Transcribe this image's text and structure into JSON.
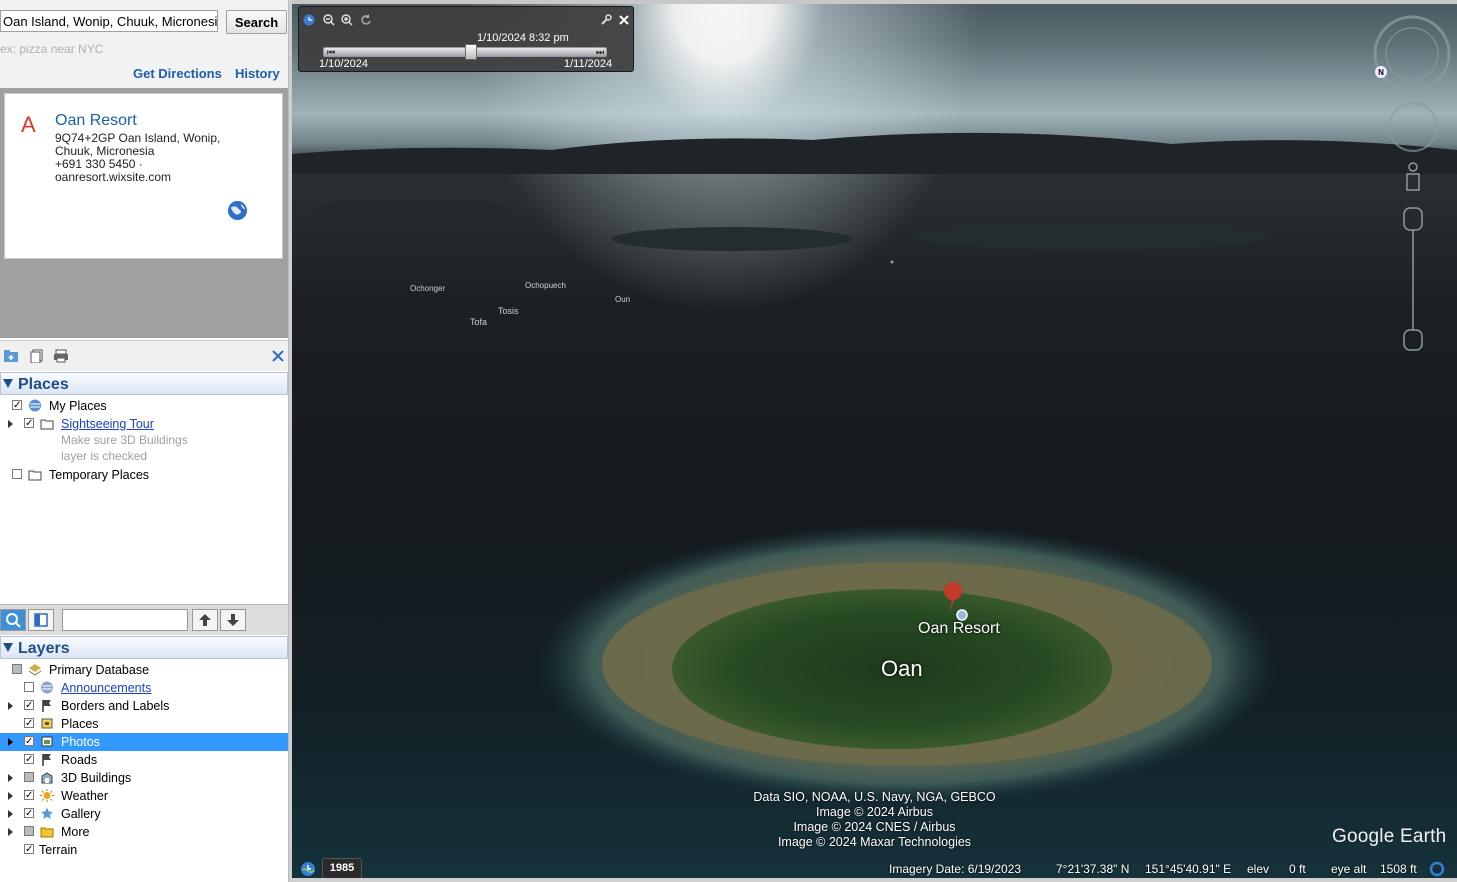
{
  "search": {
    "value": "Oan Island, Wonip, Chuuk, Micronesia",
    "button_label": "Search",
    "hint": "ex: pizza near NYC",
    "get_directions": "Get Directions",
    "history": "History"
  },
  "result": {
    "marker": "A",
    "title": "Oan Resort",
    "address1": "9Q74+2GP Oan Island, Wonip,",
    "address2": "Chuuk, Micronesia",
    "phone": "+691 330 5450 ·",
    "website": "oanresort.wixsite.com"
  },
  "places": {
    "title": "Places",
    "my_places": "My Places",
    "sightseeing_tour": "Sightseeing Tour",
    "hint1": "Make sure 3D Buildings",
    "hint2": "layer is checked",
    "temporary_places": "Temporary Places"
  },
  "layers": {
    "title": "Layers",
    "items": [
      {
        "label": "Primary Database"
      },
      {
        "label": "Announcements"
      },
      {
        "label": "Borders and Labels"
      },
      {
        "label": "Places"
      },
      {
        "label": "Photos"
      },
      {
        "label": "Roads"
      },
      {
        "label": "3D Buildings"
      },
      {
        "label": "Weather"
      },
      {
        "label": "Gallery"
      },
      {
        "label": "More"
      },
      {
        "label": "Terrain"
      }
    ]
  },
  "timeslider": {
    "current": "1/10/2024   8:32 pm",
    "start": "1/10/2024",
    "end": "1/11/2024",
    "position_fraction": 0.52
  },
  "map_labels": {
    "ochonger": "Ochonger",
    "ochopuech": "Ochopuech",
    "oun": "Oun",
    "tosis": "Tosis",
    "tofa": "Tofa",
    "oan": "Oan",
    "oan_resort": "Oan Resort"
  },
  "attribution": [
    "Data SIO, NOAA, U.S. Navy, NGA, GEBCO",
    "Image © 2024 Airbus",
    "Image © 2024 CNES / Airbus",
    "Image © 2024 Maxar Technologies"
  ],
  "logo": "Google Earth",
  "status": {
    "year": "1985",
    "imagery_date": "Imagery Date: 6/19/2023",
    "lat": "7°21'37.38\" N",
    "lon": "151°45'40.91\" E",
    "elev_label": "elev",
    "elev_value": "0 ft",
    "eye_label": "eye alt",
    "eye_value": "1508 ft"
  },
  "colors": {
    "link": "#1c5fb0",
    "selection": "#3399ff",
    "panel_title": "#1f4e8b",
    "marker": "#d83a2c"
  }
}
